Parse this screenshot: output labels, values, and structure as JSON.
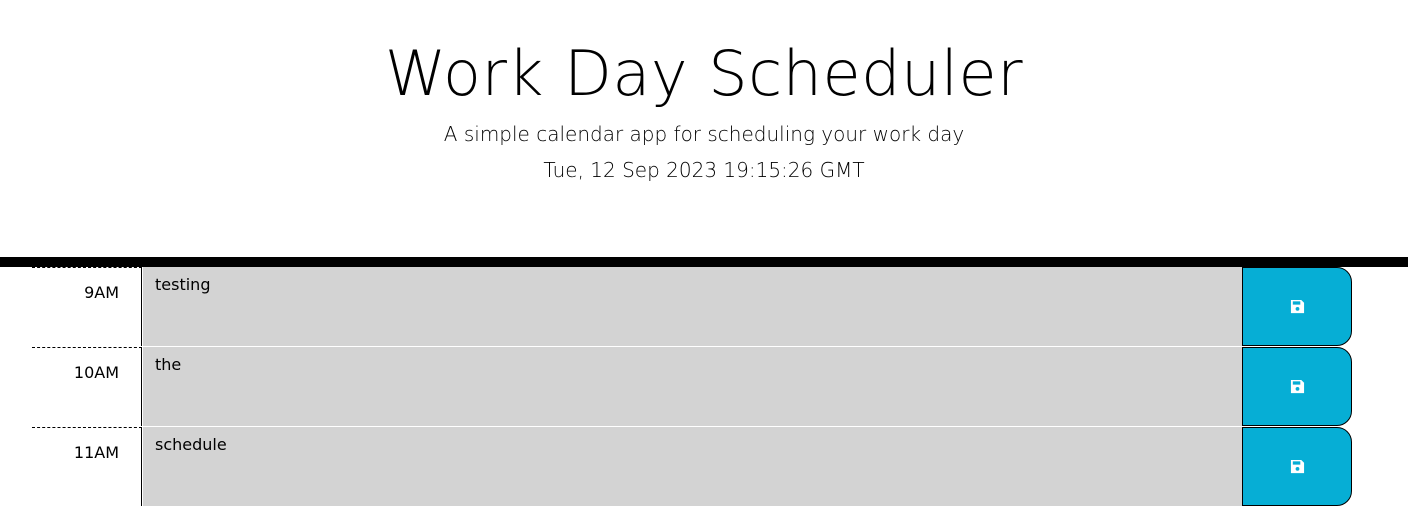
{
  "header": {
    "title": "Work Day Scheduler",
    "subtitle": "A simple calendar app for scheduling your work day",
    "current_day": "Tue, 12 Sep 2023 19:15:26 GMT"
  },
  "time_blocks": [
    {
      "hour": "9AM",
      "text": "testing",
      "save_icon": "floppy-disk-icon"
    },
    {
      "hour": "10AM",
      "text": "the",
      "save_icon": "floppy-disk-icon"
    },
    {
      "hour": "11AM",
      "text": "schedule",
      "save_icon": "floppy-disk-icon"
    }
  ],
  "colors": {
    "past_block": "#d3d3d3",
    "save_button": "#06aed5",
    "header_border": "#000000"
  }
}
